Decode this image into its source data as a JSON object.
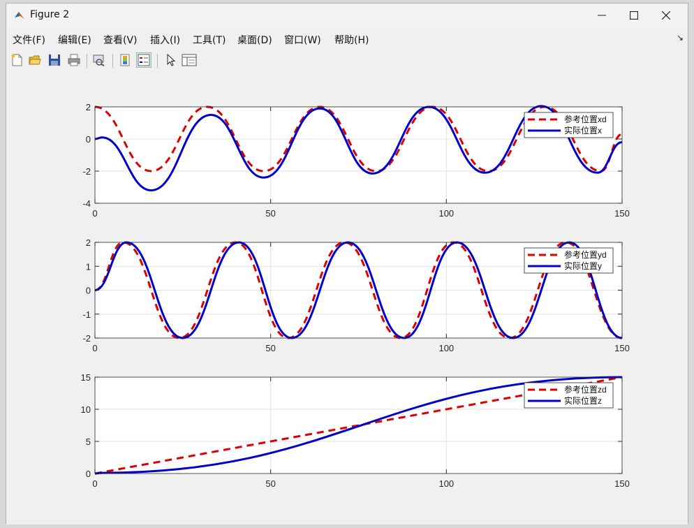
{
  "window": {
    "title": "Figure 2"
  },
  "menu": [
    {
      "label": "文件(F)"
    },
    {
      "label": "编辑(E)"
    },
    {
      "label": "查看(V)"
    },
    {
      "label": "插入(I)"
    },
    {
      "label": "工具(T)"
    },
    {
      "label": "桌面(D)"
    },
    {
      "label": "窗口(W)"
    },
    {
      "label": "帮助(H)"
    }
  ],
  "toolbar": [
    "new-figure",
    "open-file",
    "save",
    "print",
    "print-preview",
    "colorbar",
    "legend",
    "pointer",
    "property-inspector"
  ],
  "colors": {
    "reference": "#dd0000",
    "actual": "#0000cc"
  },
  "chart_data": [
    {
      "type": "line",
      "xlim": [
        0,
        150
      ],
      "ylim": [
        -4,
        2
      ],
      "xticks": [
        "0",
        "50",
        "100",
        "150"
      ],
      "yticks": [
        "-4",
        "-2",
        "0",
        "2"
      ],
      "grid": true,
      "legend_position": "top-right",
      "series": [
        {
          "name": "参考位置xd",
          "style": "dashed",
          "x": [
            0,
            16,
            32,
            48,
            64,
            80,
            96,
            112,
            128,
            144,
            150
          ],
          "y": [
            2,
            -2,
            2,
            -2,
            2,
            -2,
            2,
            -2,
            2,
            -2,
            0.3
          ]
        },
        {
          "name": "实际位置x",
          "style": "solid",
          "x": [
            0,
            2,
            16,
            33,
            48,
            64,
            79,
            95,
            111,
            127,
            143,
            150
          ],
          "y": [
            0,
            0.1,
            -3.2,
            1.5,
            -2.4,
            1.9,
            -2.15,
            2,
            -2.1,
            2.05,
            -2.1,
            -0.2
          ]
        }
      ]
    },
    {
      "type": "line",
      "xlim": [
        0,
        150
      ],
      "ylim": [
        -2,
        2
      ],
      "xticks": [
        "0",
        "50",
        "100",
        "150"
      ],
      "yticks": [
        "-2",
        "-1",
        "0",
        "1",
        "2"
      ],
      "grid": true,
      "legend_position": "top-right",
      "series": [
        {
          "name": "参考位置yd",
          "style": "dashed",
          "x": [
            0,
            8,
            24,
            40,
            55,
            71,
            87,
            102,
            118,
            134,
            150
          ],
          "y": [
            0,
            2,
            -2,
            2,
            -2,
            2,
            -2,
            2,
            -2,
            2,
            -2
          ]
        },
        {
          "name": "实际位置y",
          "style": "solid",
          "x": [
            0,
            9,
            25,
            41,
            56,
            72,
            88,
            103,
            119,
            135,
            150
          ],
          "y": [
            0,
            2,
            -2,
            2,
            -2,
            2,
            -2,
            2,
            -2,
            2,
            -2
          ]
        }
      ]
    },
    {
      "type": "line",
      "xlim": [
        0,
        150
      ],
      "ylim": [
        0,
        15
      ],
      "xticks": [
        "0",
        "50",
        "100",
        "150"
      ],
      "yticks": [
        "0",
        "5",
        "10",
        "15"
      ],
      "grid": true,
      "legend_position": "top-right",
      "series": [
        {
          "name": "参考位置zd",
          "style": "dashed",
          "x": [
            0,
            150
          ],
          "y": [
            0,
            15
          ]
        },
        {
          "name": "实际位置z",
          "style": "solid",
          "x": [
            0,
            2,
            150
          ],
          "y": [
            0,
            0.1,
            15
          ]
        }
      ]
    }
  ]
}
